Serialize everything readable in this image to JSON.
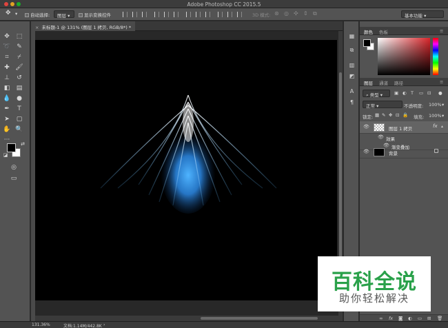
{
  "app": {
    "title": "Adobe Photoshop CC 2015.5"
  },
  "options_bar": {
    "auto_select_label": "自动选择:",
    "auto_select_value": "图层",
    "show_transform_label": "显示变换控件",
    "mode_3d_label": "3D 模式:",
    "workspace_value": "基本功能"
  },
  "document": {
    "tab_title": "未标题-1 @ 131% (图层 1 拷贝, RGB/8*) *"
  },
  "status": {
    "zoom": "131.36%",
    "doc_size": "文档:1.14M/442.8K"
  },
  "color_panel": {
    "tabs": [
      "颜色",
      "色板"
    ],
    "foreground": "#000000",
    "background": "#ffffff",
    "picked_hue": "#d9262b"
  },
  "layers_panel": {
    "tabs": [
      "图层",
      "通道",
      "路径"
    ],
    "filter_kind": "类型",
    "blend_mode": "正常",
    "opacity_label": "不透明度:",
    "opacity_value": "100%",
    "lock_label": "锁定:",
    "fill_label": "填充:",
    "fill_value": "100%",
    "layers": [
      {
        "name": "图层 1 拷贝",
        "fx": "fx",
        "effects_label": "效果",
        "effect": "渐变叠加"
      },
      {
        "name": "背景"
      }
    ]
  },
  "watermark": {
    "title": "百科全说",
    "subtitle": "助你轻松解决"
  }
}
